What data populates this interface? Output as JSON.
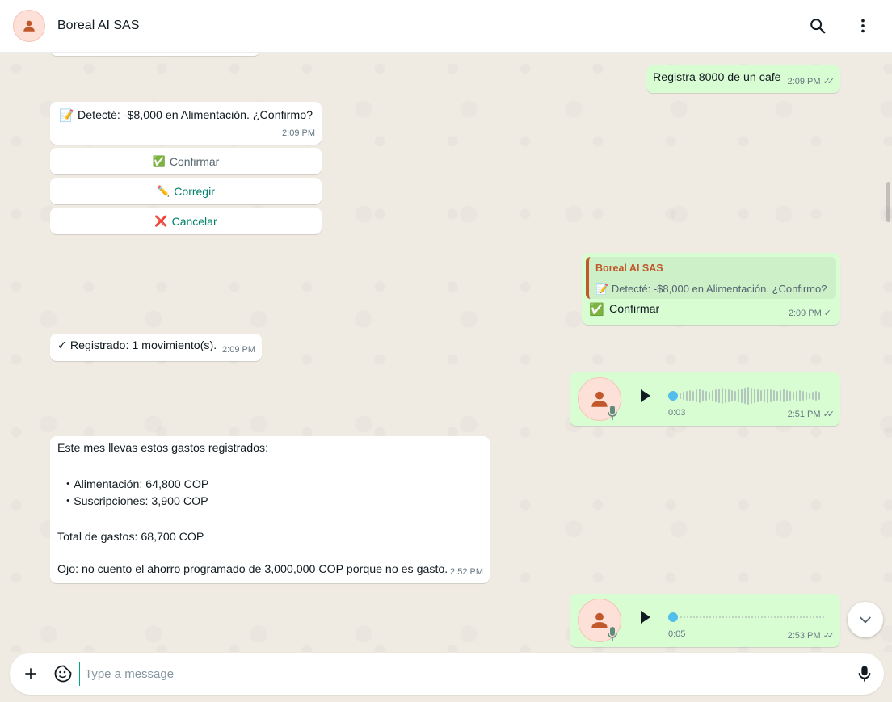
{
  "header": {
    "contact_name": "Boreal AI SAS",
    "icons": [
      "person-icon",
      "search-icon",
      "more-vert-icon"
    ]
  },
  "messages": {
    "m1": {
      "text": "Registra 8000 de un cafe",
      "time": "2:09 PM",
      "status": "read"
    },
    "m2": {
      "emoji": "📝",
      "text": "Detecté: -$8,000 en Alimentación. ¿Confirmo?",
      "time": "2:09 PM"
    },
    "quick_replies": {
      "confirm": {
        "emoji": "✅",
        "label": "Confirmar"
      },
      "edit": {
        "emoji": "✏️",
        "label": "Corregir"
      },
      "cancel": {
        "emoji": "❌",
        "label": "Cancelar"
      }
    },
    "m3": {
      "quote_author": "Boreal AI SAS",
      "quote_emoji": "📝",
      "quote_text": "Detecté: -$8,000 en Alimentación. ¿Confirmo?",
      "emoji": "✅",
      "text": "Confirmar",
      "time": "2:09 PM",
      "status": "sent"
    },
    "m4": {
      "text": "✓ Registrado: 1 movimiento(s).",
      "time": "2:09 PM"
    },
    "m5": {
      "duration": "0:03",
      "time": "2:51 PM",
      "status": "read",
      "progress": 0
    },
    "m6": {
      "line1": "Este mes llevas estos gastos registrados:",
      "item1": "・Alimentación: 64,800 COP",
      "item2": "・Suscripciones: 3,900 COP",
      "total": "Total de gastos: 68,700 COP",
      "note": "Ojo: no cuento el ahorro programado de 3,000,000 COP porque no es gasto.",
      "time": "2:52 PM"
    },
    "m7": {
      "duration": "0:05",
      "time": "2:53 PM",
      "status": "read",
      "progress": 0
    }
  },
  "composer": {
    "placeholder": "Type a message",
    "icons": [
      "plus-icon",
      "sticker-icon",
      "mic-icon"
    ]
  },
  "colors": {
    "incoming": "#ffffff",
    "outgoing": "#d9fdd3",
    "accent": "#00a884",
    "read_tick": "#667781",
    "quote_bar": "#c0582b",
    "audio_dot": "#53bdeb"
  }
}
